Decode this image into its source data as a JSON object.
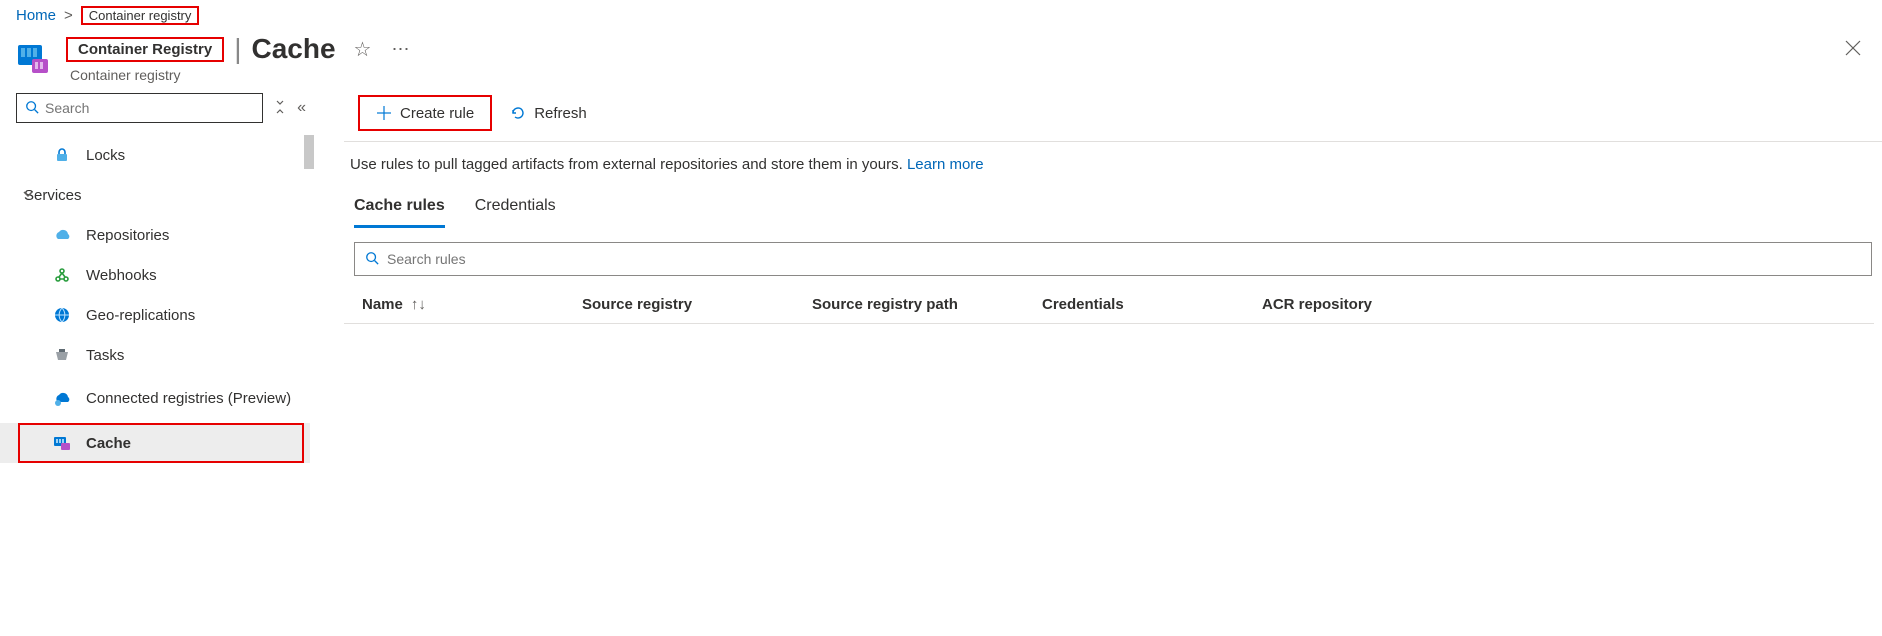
{
  "breadcrumb": {
    "home": "Home",
    "current": "Container registry"
  },
  "header": {
    "registry_name": "Container Registry",
    "page_title": "Cache",
    "sub_type": "Container registry"
  },
  "sidebar": {
    "search_placeholder": "Search",
    "items": {
      "locks": "Locks",
      "services": "Services",
      "repositories": "Repositories",
      "webhooks": "Webhooks",
      "geo": "Geo-replications",
      "tasks": "Tasks",
      "connected": "Connected registries (Preview)",
      "cache": "Cache"
    }
  },
  "toolbar": {
    "create": "Create rule",
    "refresh": "Refresh"
  },
  "description": {
    "text": "Use rules to pull tagged artifacts from external repositories and store them in yours. ",
    "link": "Learn more"
  },
  "tabs": {
    "rules": "Cache rules",
    "creds": "Credentials"
  },
  "rules_search_placeholder": "Search rules",
  "columns": {
    "name": "Name",
    "src": "Source registry",
    "path": "Source registry path",
    "cred": "Credentials",
    "acr": "ACR repository"
  }
}
